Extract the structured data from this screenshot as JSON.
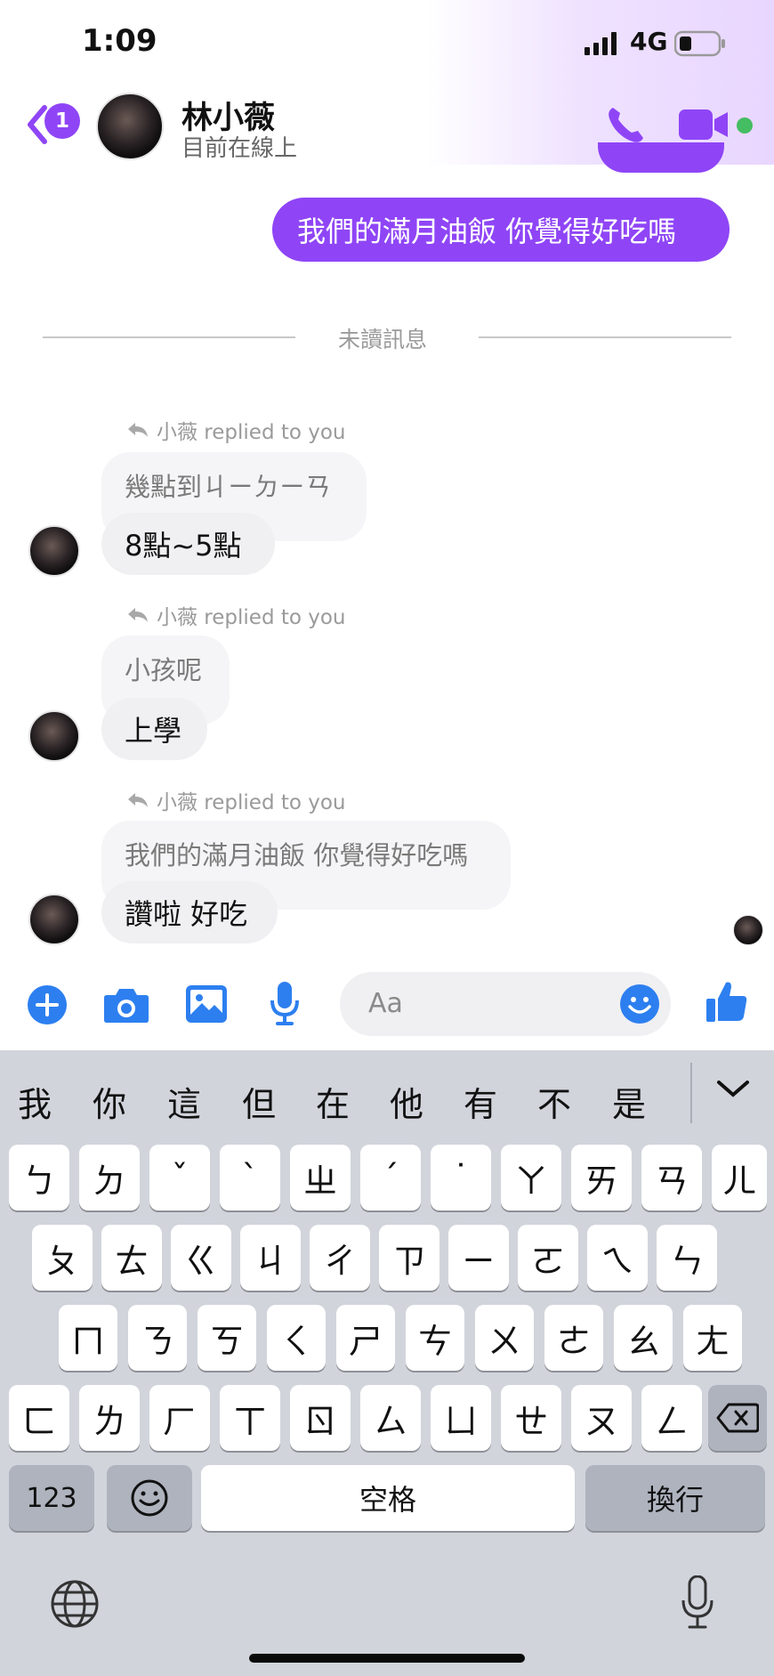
{
  "status_bar": {
    "time": "1:09",
    "network": "4G"
  },
  "header": {
    "back_badge": "1",
    "contact_name": "林小薇",
    "contact_status": "目前在線上"
  },
  "messages": {
    "outgoing_last": "我們的滿月油飯 你覺得好吃嗎",
    "unread_divider": "未讀訊息",
    "threads": [
      {
        "replied_note": "小薇 replied to you",
        "quoted": "幾點到ㄐㄧㄉㄧㄢ",
        "reply": "8點~5點"
      },
      {
        "replied_note": "小薇 replied to you",
        "quoted": "小孩呢",
        "reply": "上學"
      },
      {
        "replied_note": "小薇 replied to you",
        "quoted": "我們的滿月油飯 你覺得好吃嗎",
        "reply": "讚啦 好吃"
      }
    ]
  },
  "composer": {
    "placeholder": "Aa"
  },
  "keyboard": {
    "candidates": [
      "我",
      "你",
      "這",
      "但",
      "在",
      "他",
      "有",
      "不",
      "是"
    ],
    "row1": [
      "ㄅ",
      "ㄉ",
      "ˇ",
      "ˋ",
      "ㄓ",
      "ˊ",
      "˙",
      "ㄚ",
      "ㄞ",
      "ㄢ",
      "ㄦ"
    ],
    "row2": [
      "ㄆ",
      "ㄊ",
      "ㄍ",
      "ㄐ",
      "ㄔ",
      "ㄗ",
      "ㄧ",
      "ㄛ",
      "ㄟ",
      "ㄣ"
    ],
    "row3": [
      "ㄇ",
      "ㄋ",
      "ㄎ",
      "ㄑ",
      "ㄕ",
      "ㄘ",
      "ㄨ",
      "ㄜ",
      "ㄠ",
      "ㄤ"
    ],
    "row4": [
      "ㄈ",
      "ㄌ",
      "ㄏ",
      "ㄒ",
      "ㄖ",
      "ㄙ",
      "ㄩ",
      "ㄝ",
      "ㄡ",
      "ㄥ"
    ],
    "numbers_key": "123",
    "space_key": "空格",
    "return_key": "換行"
  },
  "colors": {
    "accent": "#8f45f6",
    "composer_icon": "#2d7ff0",
    "online": "#45bd62"
  }
}
